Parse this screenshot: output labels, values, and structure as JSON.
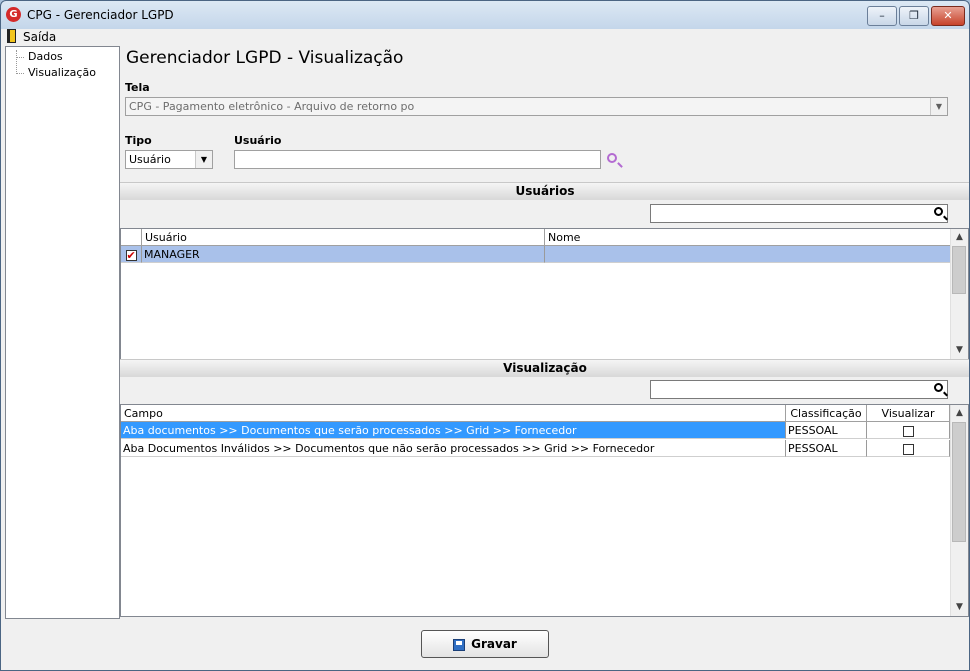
{
  "window": {
    "title": "CPG - Gerenciador LGPD",
    "app_icon": "G"
  },
  "window_controls": {
    "minimize": "–",
    "maximize": "❐",
    "close": "✕"
  },
  "menu": {
    "exit_label": "Saída"
  },
  "nav": {
    "items": [
      "Dados",
      "Visualização"
    ]
  },
  "page": {
    "title": "Gerenciador LGPD - Visualização"
  },
  "form": {
    "tela_label": "Tela",
    "tela_value": "CPG - Pagamento eletrônico - Arquivo de retorno po",
    "tipo_label": "Tipo",
    "tipo_value": "Usuário",
    "usuario_label": "Usuário",
    "usuario_value": ""
  },
  "users_section": {
    "title": "Usuários",
    "filter_value": "",
    "columns": [
      "Usuário",
      "Nome"
    ],
    "rows": [
      {
        "checked": true,
        "usuario": "MANAGER",
        "nome": ""
      }
    ]
  },
  "view_section": {
    "title": "Visualização",
    "filter_value": "",
    "columns": [
      "Campo",
      "Classificação",
      "Visualizar"
    ],
    "rows": [
      {
        "campo": "Aba documentos >> Documentos que serão processados >> Grid >> Fornecedor",
        "classificacao": "PESSOAL",
        "visualizar": false
      },
      {
        "campo": "Aba Documentos Inválidos >> Documentos que não serão processados >> Grid >> Fornecedor",
        "classificacao": "PESSOAL",
        "visualizar": false
      }
    ]
  },
  "footer": {
    "save_label": "Gravar"
  },
  "colors": {
    "selected_row": "#a9c1ea",
    "highlight_row": "#3399ff",
    "accent": "#b36bd1"
  }
}
